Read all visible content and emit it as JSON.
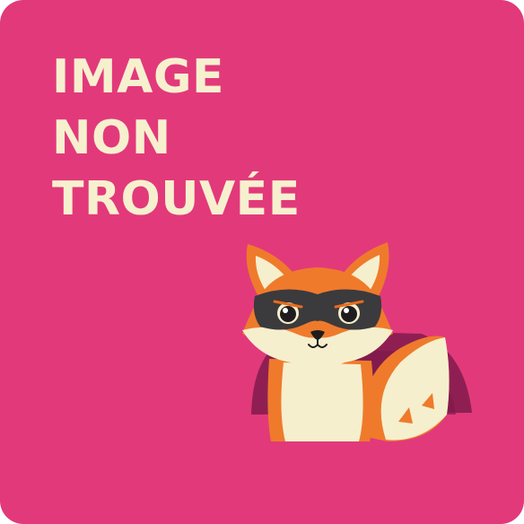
{
  "message": {
    "lines": [
      "IMAGE",
      "NON",
      "TROUVÉE"
    ]
  },
  "colors": {
    "background": "#e2397b",
    "text": "#f7f0cf",
    "fox_orange": "#ef7a2c",
    "fox_cream": "#f6efcd",
    "mask": "#3b3a3d",
    "hole": "#8f1f53"
  },
  "illustration": {
    "icon": "fox-peeking-from-hole-icon"
  }
}
